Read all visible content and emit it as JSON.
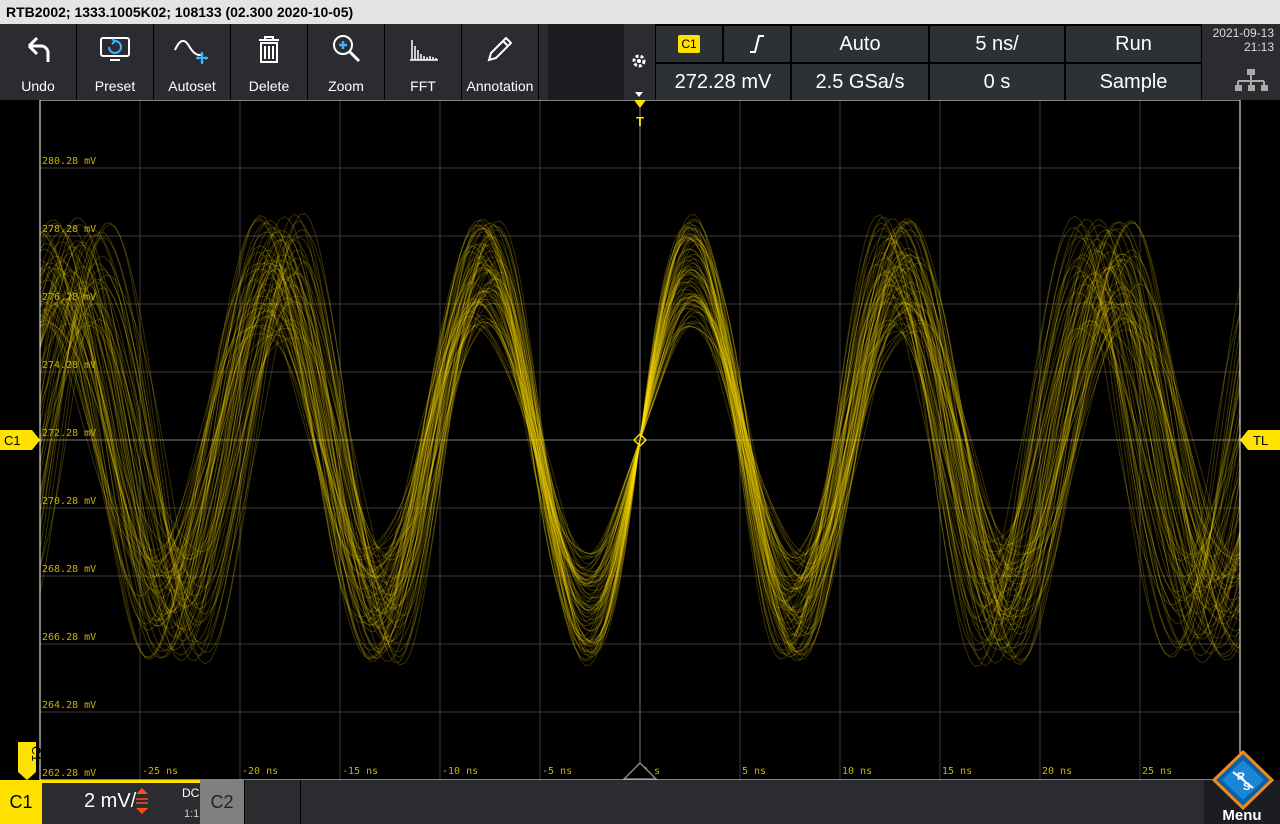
{
  "title": "RTB2002; 1333.1005K02; 108133 (02.300 2020-10-05)",
  "toolbar": {
    "undo": "Undo",
    "preset": "Preset",
    "autoset": "Autoset",
    "delete": "Delete",
    "zoom": "Zoom",
    "fft": "FFT",
    "annotation": "Annotation"
  },
  "trigger": {
    "source": "C1",
    "slope_icon": "rising-edge-icon",
    "mode": "Auto",
    "timebase": "5 ns/",
    "run_state": "Run",
    "level": "272.28 mV",
    "sample_rate": "2.5 GSa/s",
    "offset": "0 s",
    "acquisition": "Sample"
  },
  "datetime": {
    "date": "2021-09-13",
    "time": "21:13"
  },
  "markers": {
    "channel": "C1",
    "trigger_level": "TL",
    "trigger_pos": "T"
  },
  "y_labels": [
    "280.28 mV",
    "278.28 mV",
    "276.28 mV",
    "274.28 mV",
    "272.28 mV",
    "270.28 mV",
    "268.28 mV",
    "266.28 mV",
    "264.28 mV",
    "262.28 mV"
  ],
  "x_labels": [
    "-25 ns",
    "-20 ns",
    "-15 ns",
    "-10 ns",
    "-5 ns",
    "0 s",
    "5 ns",
    "10 ns",
    "15 ns",
    "20 ns",
    "25 ns"
  ],
  "channel_bar": {
    "c1": "C1",
    "scale": "2 mV/",
    "coupling": "DC",
    "probe": "1:1",
    "c2": "C2"
  },
  "menu": "Menu",
  "colors": {
    "trace": "#ffe100",
    "grid": "#3a3a3a"
  },
  "chart_data": {
    "type": "line",
    "xlabel": "",
    "ylabel": "",
    "xlim": [
      -30,
      30
    ],
    "ylim": [
      262.28,
      282.28
    ],
    "x_unit": "ns",
    "y_unit": "mV",
    "center": 272.28,
    "amplitude": 6,
    "period_ns": 10.3,
    "traces": 70,
    "grid": true
  }
}
